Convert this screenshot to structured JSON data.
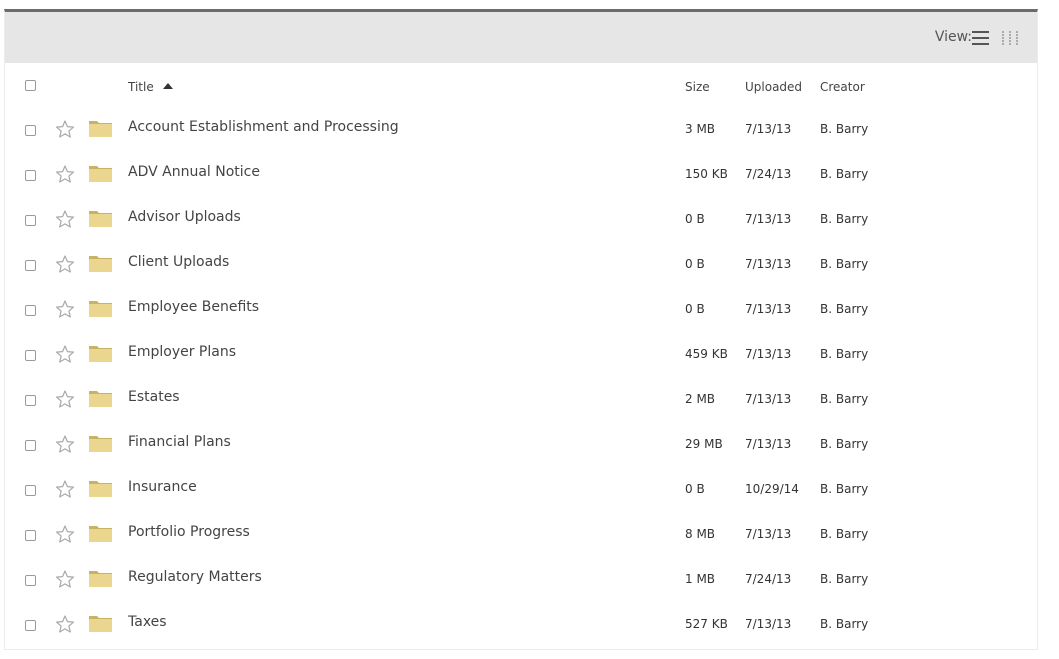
{
  "toolbar": {
    "view_label": "View:",
    "list_icon": "list-view-icon",
    "grid_icon": "grid-view-icon"
  },
  "columns": {
    "title": "Title",
    "size": "Size",
    "uploaded": "Uploaded",
    "creator": "Creator",
    "sort_direction": "ascending"
  },
  "colors": {
    "toolbar_bg": "#e6e6e6",
    "top_border": "#6b6b6b",
    "folder": "#e8d48e",
    "folder_tab": "#c9b264",
    "star": "#a8a8a8"
  },
  "rows": [
    {
      "title": "Account Establishment and Processing",
      "size": "3 MB",
      "uploaded": "7/13/13",
      "creator": "B. Barry"
    },
    {
      "title": "ADV Annual Notice",
      "size": "150 KB",
      "uploaded": "7/24/13",
      "creator": "B. Barry"
    },
    {
      "title": "Advisor Uploads",
      "size": "0 B",
      "uploaded": "7/13/13",
      "creator": "B. Barry"
    },
    {
      "title": "Client Uploads",
      "size": "0 B",
      "uploaded": "7/13/13",
      "creator": "B. Barry"
    },
    {
      "title": "Employee Benefits",
      "size": "0 B",
      "uploaded": "7/13/13",
      "creator": "B. Barry"
    },
    {
      "title": "Employer Plans",
      "size": "459 KB",
      "uploaded": "7/13/13",
      "creator": "B. Barry"
    },
    {
      "title": "Estates",
      "size": "2 MB",
      "uploaded": "7/13/13",
      "creator": "B. Barry"
    },
    {
      "title": "Financial Plans",
      "size": "29 MB",
      "uploaded": "7/13/13",
      "creator": "B. Barry"
    },
    {
      "title": "Insurance",
      "size": "0 B",
      "uploaded": "10/29/14",
      "creator": "B. Barry"
    },
    {
      "title": "Portfolio Progress",
      "size": "8 MB",
      "uploaded": "7/13/13",
      "creator": "B. Barry"
    },
    {
      "title": "Regulatory Matters",
      "size": "1 MB",
      "uploaded": "7/24/13",
      "creator": "B. Barry"
    },
    {
      "title": "Taxes",
      "size": "527 KB",
      "uploaded": "7/13/13",
      "creator": "B. Barry"
    }
  ]
}
